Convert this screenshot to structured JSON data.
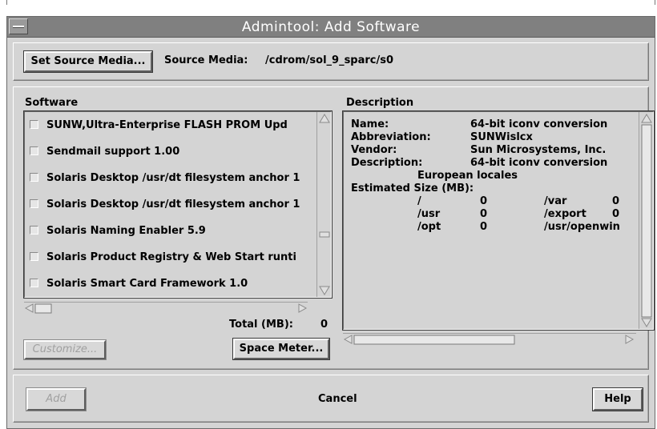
{
  "window": {
    "title": "Admintool: Add Software",
    "menu_button": "window-menu"
  },
  "source": {
    "set_button": "Set Source Media...",
    "label": "Source Media:",
    "value": "/cdrom/sol_9_sparc/s0"
  },
  "software": {
    "heading": "Software",
    "items": [
      "SUNW,Ultra-Enterprise FLASH PROM Upd",
      "Sendmail support 1.00",
      "Solaris Desktop /usr/dt filesystem anchor 1",
      "Solaris Desktop /usr/dt filesystem anchor 1",
      "Solaris Naming Enabler 5.9",
      "Solaris Product Registry & Web Start runti",
      "Solaris Smart Card Framework 1.0"
    ],
    "total_label": "Total (MB):",
    "total_value": "0",
    "customize_button": "Customize...",
    "space_meter_button": "Space Meter..."
  },
  "description": {
    "heading": "Description",
    "name_label": "Name:",
    "name_value": "64-bit iconv conversion",
    "abbr_label": "Abbreviation:",
    "abbr_value": "SUNWislcx",
    "vendor_label": "Vendor:",
    "vendor_value": "Sun Microsystems, Inc.",
    "desc_label": "Description:",
    "desc_value": "64-bit iconv conversion",
    "desc_cont": "European locales",
    "size_label": "Estimated Size (MB):",
    "sizes": [
      {
        "path": "/",
        "value": "0"
      },
      {
        "path": "/var",
        "value": "0"
      },
      {
        "path": "/usr",
        "value": "0"
      },
      {
        "path": "/export",
        "value": "0"
      },
      {
        "path": "/opt",
        "value": "0"
      },
      {
        "path": "/usr/openwin",
        "value": ""
      }
    ]
  },
  "footer": {
    "add_button": "Add",
    "cancel_button": "Cancel",
    "help_button": "Help"
  }
}
